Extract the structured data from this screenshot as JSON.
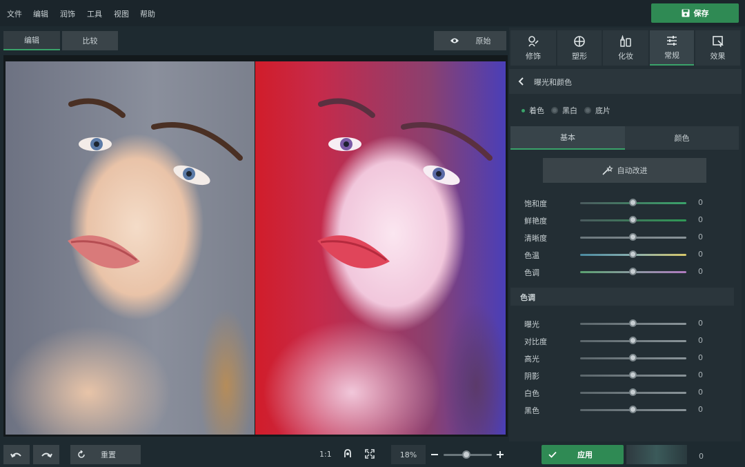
{
  "menu": {
    "items": [
      "文件",
      "编辑",
      "润饰",
      "工具",
      "视图",
      "帮助"
    ]
  },
  "save_label": "保存",
  "left_tabs": {
    "edit": "编辑",
    "compare": "比较",
    "original": "原始"
  },
  "tool_tabs": [
    {
      "label": "修饰",
      "icon": "retouch-icon"
    },
    {
      "label": "塑形",
      "icon": "reshape-icon"
    },
    {
      "label": "化妆",
      "icon": "makeup-icon"
    },
    {
      "label": "常规",
      "icon": "sliders-icon"
    },
    {
      "label": "效果",
      "icon": "effects-icon"
    }
  ],
  "section_title": "曝光和颜色",
  "color_modes": [
    "着色",
    "黑白",
    "底片"
  ],
  "sub_tabs": {
    "basic": "基本",
    "color": "颜色"
  },
  "auto_enhance": "自动改进",
  "basic_sliders": [
    {
      "label": "饱和度",
      "value": "0"
    },
    {
      "label": "鲜艳度",
      "value": "0"
    },
    {
      "label": "清晰度",
      "value": "0"
    },
    {
      "label": "色温",
      "value": "0"
    },
    {
      "label": "色调",
      "value": "0"
    }
  ],
  "tone_section": "色调",
  "tone_sliders": [
    {
      "label": "曝光",
      "value": "0"
    },
    {
      "label": "对比度",
      "value": "0"
    },
    {
      "label": "高光",
      "value": "0"
    },
    {
      "label": "阴影",
      "value": "0"
    },
    {
      "label": "白色",
      "value": "0"
    },
    {
      "label": "黑色",
      "value": "0"
    }
  ],
  "bottom": {
    "reset": "重置",
    "ratio": "1:1",
    "zoom": "18%",
    "apply": "应用",
    "preset_value": "0"
  },
  "colors": {
    "accent": "#3aa36a",
    "panel": "#232e34",
    "bg": "#1e2a30"
  }
}
